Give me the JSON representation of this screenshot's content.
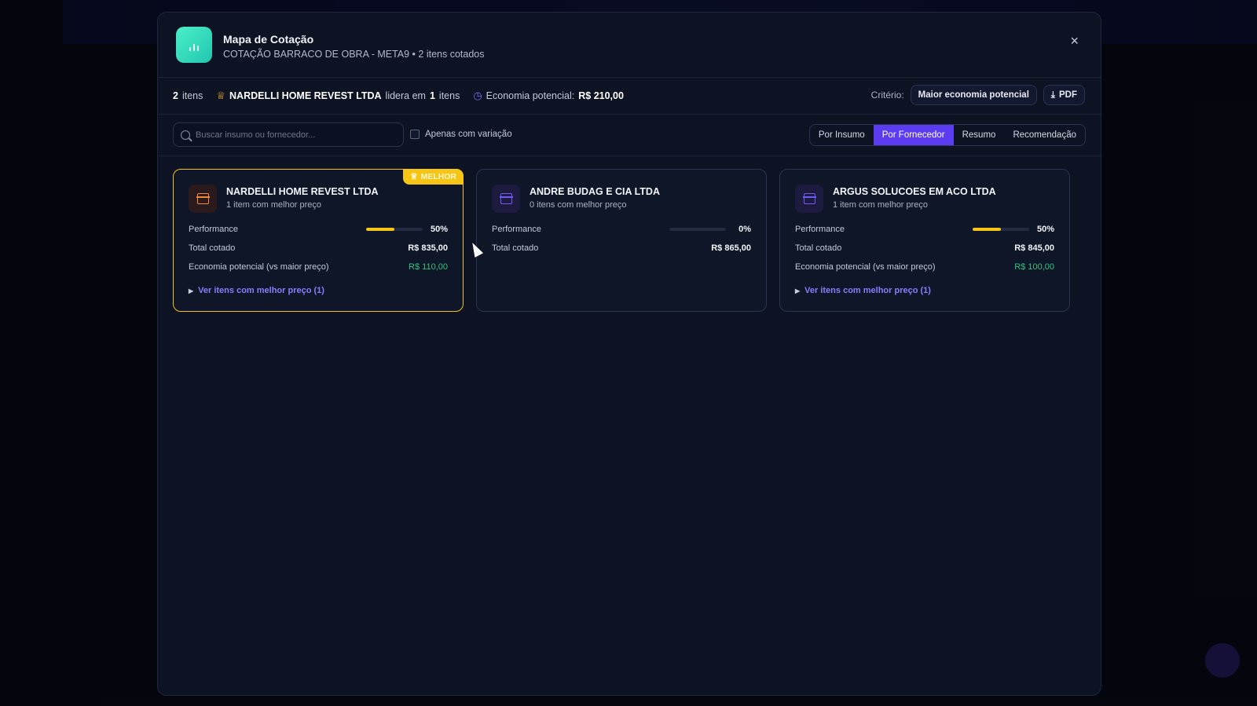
{
  "modal": {
    "title": "Mapa de Cotação",
    "subtitle": "COTAÇÃO BARRACO DE OBRA - META9 • 2 itens cotados",
    "close_label": "×"
  },
  "stats": {
    "items_count": "2",
    "items_label": "itens",
    "leader_name": "NARDELLI HOME REVEST LTDA",
    "leads_in_label": "lidera em",
    "leads_count": "1",
    "leads_items_label": "itens",
    "economy_label": "Economia potencial:",
    "economy_value": "R$ 210,00",
    "criteria_label": "Critério:",
    "criteria_value": "Maior economia potencial",
    "pdf_label": "PDF"
  },
  "toolbar": {
    "search_placeholder": "Buscar insumo ou fornecedor...",
    "only_variation_label": "Apenas com variação",
    "tabs": [
      {
        "label": "Por Insumo",
        "active": false
      },
      {
        "label": "Por Fornecedor",
        "active": true
      },
      {
        "label": "Resumo",
        "active": false
      },
      {
        "label": "Recomendação",
        "active": false
      }
    ]
  },
  "cards": [
    {
      "name": "NARDELLI HOME REVEST LTDA",
      "subtitle": "1 item com melhor preço",
      "badge": "MELHOR",
      "icon_color": "orange",
      "performance_label": "Performance",
      "performance": 50,
      "performance_text": "50%",
      "total_label": "Total cotado",
      "total_value": "R$ 835,00",
      "economy_label": "Economia potencial (vs maior preço)",
      "economy_value": "R$ 110,00",
      "link_label": "Ver itens com melhor preço (1)"
    },
    {
      "name": "ANDRE BUDAG E CIA LTDA",
      "subtitle": "0 itens com melhor preço",
      "icon_color": "purple",
      "performance_label": "Performance",
      "performance": 0,
      "performance_text": "0%",
      "total_label": "Total cotado",
      "total_value": "R$ 865,00"
    },
    {
      "name": "ARGUS SOLUCOES EM ACO LTDA",
      "subtitle": "1 item com melhor preço",
      "icon_color": "purple",
      "performance_label": "Performance",
      "performance": 50,
      "performance_text": "50%",
      "total_label": "Total cotado",
      "total_value": "R$ 845,00",
      "economy_label": "Economia potencial (vs maior preço)",
      "economy_value": "R$ 100,00",
      "link_label": "Ver itens com melhor preço (1)"
    }
  ],
  "colors": {
    "accent": "#5b3cf0",
    "best_border": "#f2c21b",
    "economy_green": "#2fc47e",
    "brand_teal": "#2dd9b9"
  }
}
